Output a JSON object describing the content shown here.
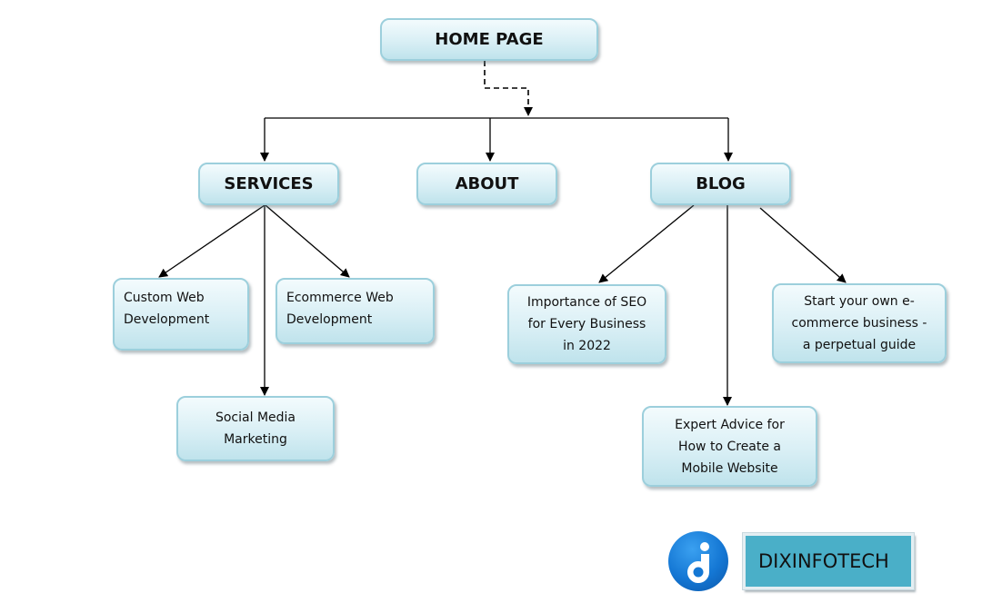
{
  "diagram": {
    "type": "sitemap-tree",
    "nodes": {
      "home": {
        "label": "HOME PAGE"
      },
      "services": {
        "label": "SERVICES"
      },
      "about": {
        "label": "ABOUT"
      },
      "blog": {
        "label": "BLOG"
      },
      "custom_web": {
        "lines": [
          "Custom Web",
          "Development"
        ]
      },
      "ecommerce_web": {
        "lines": [
          "Ecommerce Web",
          "Development"
        ]
      },
      "social_media": {
        "lines": [
          "Social Media",
          "Marketing"
        ]
      },
      "seo": {
        "lines": [
          "Importance of SEO",
          "for Every Business",
          "in 2022"
        ]
      },
      "start_ecom": {
        "lines": [
          "Start your own e-",
          "commerce business  -",
          "a perpetual guide"
        ]
      },
      "expert_advice": {
        "lines": [
          "Expert Advice  for",
          "How to Create a",
          "Mobile Website"
        ]
      }
    },
    "edges": [
      {
        "from": "home",
        "to": "services|about|blog",
        "style": "dashed"
      },
      {
        "from": "home",
        "to": "services",
        "style": "solid"
      },
      {
        "from": "home",
        "to": "about",
        "style": "solid"
      },
      {
        "from": "home",
        "to": "blog",
        "style": "solid"
      },
      {
        "from": "services",
        "to": "custom_web",
        "style": "solid"
      },
      {
        "from": "services",
        "to": "ecommerce_web",
        "style": "solid"
      },
      {
        "from": "services",
        "to": "social_media",
        "style": "solid"
      },
      {
        "from": "blog",
        "to": "seo",
        "style": "solid"
      },
      {
        "from": "blog",
        "to": "expert_advice",
        "style": "solid"
      },
      {
        "from": "blog",
        "to": "start_ecom",
        "style": "solid"
      }
    ]
  },
  "brand": {
    "name": "DIXINFOTECH",
    "logo_icon": "dixinfotech-j-logo-icon"
  },
  "colors": {
    "node_border": "#9ccfdc",
    "node_fill": "#d9eff5",
    "brand_box": "#4aafc8",
    "logo_blue": "#1477d4",
    "line": "#000000"
  }
}
